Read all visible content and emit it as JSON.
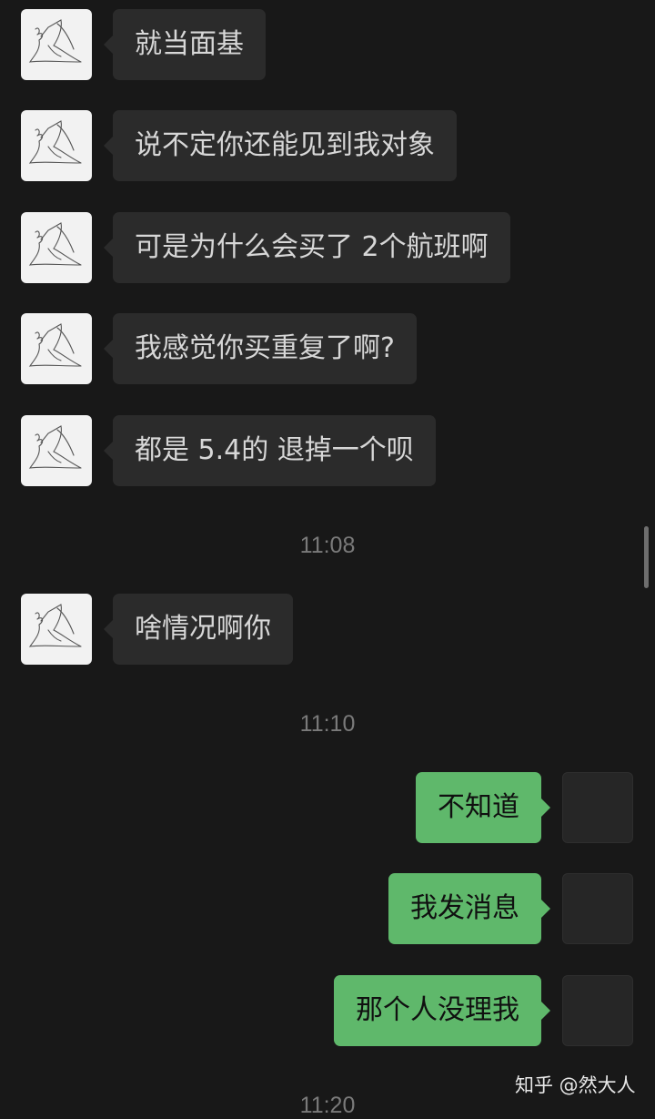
{
  "messages": [
    {
      "side": "left",
      "text": "就当面基"
    },
    {
      "side": "left",
      "text": "说不定你还能见到我对象"
    },
    {
      "side": "left",
      "text": "可是为什么会买了 2个航班啊"
    },
    {
      "side": "left",
      "text": "我感觉你买重复了啊?"
    },
    {
      "side": "left",
      "text": "都是 5.4的 退掉一个呗"
    },
    {
      "side": "left",
      "text": "啥情况啊你"
    },
    {
      "side": "right",
      "text": "不知道"
    },
    {
      "side": "right",
      "text": "我发消息"
    },
    {
      "side": "right",
      "text": "那个人没理我"
    }
  ],
  "timestamps": [
    "11:08",
    "11:10",
    "11:20"
  ],
  "watermark": "知乎 @然大人",
  "colors": {
    "background": "#181818",
    "incoming_bubble": "#2b2b2b",
    "outgoing_bubble": "#5fb86b",
    "timestamp_text": "#7a7a7a"
  },
  "icons": {
    "contact_avatar": "line-sketch-avatar",
    "self_avatar": "blank-dark-avatar"
  }
}
